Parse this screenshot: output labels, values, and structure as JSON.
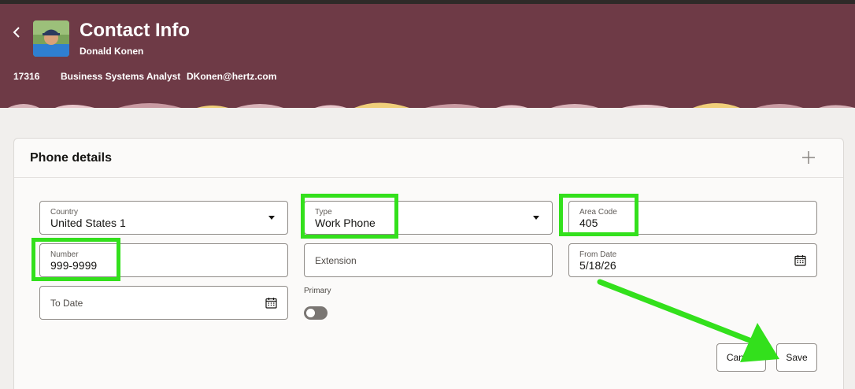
{
  "header": {
    "title": "Contact Info",
    "name": "Donald Konen",
    "employee_id": "17316",
    "job_title": "Business Systems Analyst",
    "email": "DKonen@hertz.com",
    "back_icon": "chevron-left-icon",
    "color": "#6e3a46"
  },
  "card": {
    "title": "Phone details",
    "add_icon": "plus-icon"
  },
  "form": {
    "country": {
      "label": "Country",
      "value": "United States 1"
    },
    "type": {
      "label": "Type",
      "value": "Work Phone"
    },
    "area_code": {
      "label": "Area Code",
      "value": "405"
    },
    "number": {
      "label": "Number",
      "value": "999-9999"
    },
    "extension": {
      "label": "Extension"
    },
    "from_date": {
      "label": "From Date",
      "value": "5/18/26"
    },
    "to_date": {
      "label": "To Date"
    },
    "primary": {
      "label": "Primary",
      "checked": false
    }
  },
  "buttons": {
    "cancel": "Cancel",
    "save": "Save"
  },
  "annotations": {
    "highlight_color": "#33e01c"
  }
}
